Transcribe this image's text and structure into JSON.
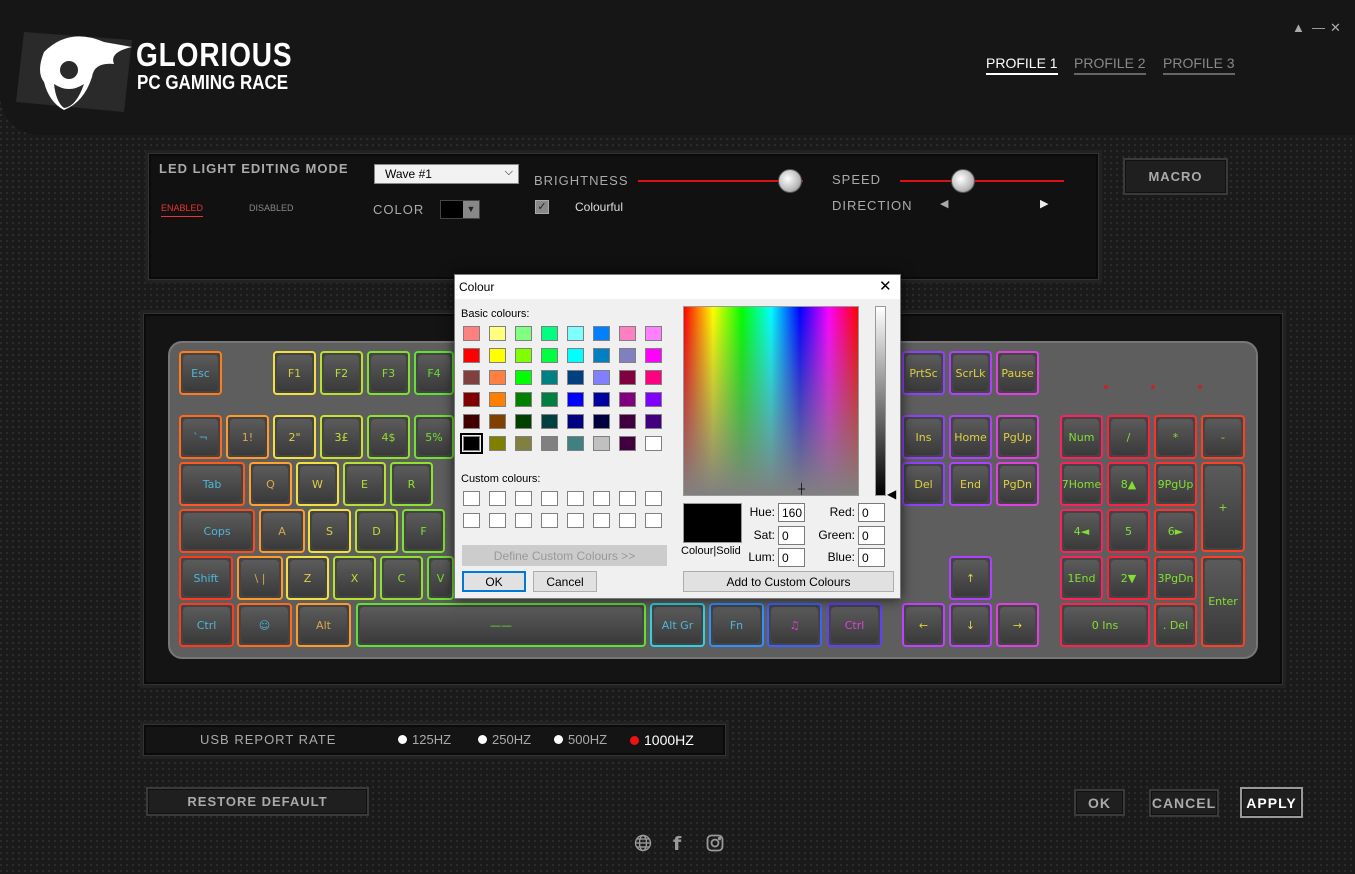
{
  "app": {
    "brand_line1": "GLORIOUS",
    "brand_line2": "PC GAMING RACE"
  },
  "window_controls": [
    "▲",
    "—",
    "✕"
  ],
  "profiles": [
    {
      "label": "PROFILE 1",
      "active": true
    },
    {
      "label": "PROFILE 2",
      "active": false
    },
    {
      "label": "PROFILE 3",
      "active": false
    }
  ],
  "led": {
    "title": "LED LIGHT EDITING MODE",
    "enabled": "ENABLED",
    "disabled": "DISABLED",
    "mode_value": "Wave #1",
    "color_label": "COLOR",
    "brightness_label": "BRIGHTNESS",
    "brightness_level": 0.88,
    "speed_label": "SPEED",
    "speed_level": 0.38,
    "direction_label": "DIRECTION",
    "colourful_label": "Colourful",
    "colourful_checked": true
  },
  "macro_label": "MACRO",
  "usb": {
    "label": "USB REPORT RATE",
    "options": [
      "125HZ",
      "250HZ",
      "500HZ",
      "1000HZ"
    ],
    "selected": "1000HZ"
  },
  "restore_label": "RESTORE DEFAULT",
  "ok_label": "OK",
  "cancel_label": "CANCEL",
  "apply_label": "APPLY",
  "social_icons": [
    "globe-icon",
    "facebook-icon",
    "instagram-icon"
  ],
  "keys": {
    "esc": "Esc",
    "f1": "F1",
    "f2": "F2",
    "f3": "F3",
    "f4": "F4",
    "grave": "`¬",
    "k1": "1!",
    "k2": "2\"",
    "k3": "3£",
    "k4": "4$",
    "k5": "5%",
    "tab": "Tab",
    "q": "Q",
    "w": "W",
    "e": "E",
    "r": "R",
    "caps": "Cops",
    "a": "A",
    "s": "S",
    "d": "D",
    "f": "F",
    "shift": "Shift",
    "bslash": "\\ |",
    "z": "Z",
    "x": "X",
    "c": "C",
    "v": "V",
    "ctrl": "Ctrl",
    "alt": "Alt",
    "altgr": "Alt Gr",
    "fn": "Fn",
    "rctrl": "Ctrl",
    "prtsc": "PrtSc",
    "scrlk": "ScrLk",
    "pause": "Pause",
    "ins": "Ins",
    "home": "Home",
    "pgup": "PgUp",
    "del": "Del",
    "end": "End",
    "pgdn": "PgDn",
    "up": "↑",
    "left": "←",
    "down": "↓",
    "right": "→",
    "num": "Num",
    "slash": "/",
    "star": "*",
    "minus": "-",
    "n7": "7Home",
    "n8": "8▲",
    "n9": "9PgUp",
    "plus": "+",
    "n4": "4◄",
    "n5": "5",
    "n6": "6►",
    "n1": "1End",
    "n2": "2▼",
    "n3": "3PgDn",
    "enter": "Enter",
    "n0": "0 Ins",
    "ndot": ". Del"
  },
  "dialog": {
    "title": "Colour",
    "basic_label": "Basic colours:",
    "custom_label": "Custom colours:",
    "define_label": "Define Custom Colours >>",
    "ok": "OK",
    "cancel": "Cancel",
    "colour_solid": "Colour|Solid",
    "add_label": "Add to Custom Colours",
    "hue_label": "Hue:",
    "sat_label": "Sat:",
    "lum_label": "Lum:",
    "red_label": "Red:",
    "green_label": "Green:",
    "blue_label": "Blue:",
    "hue": "160",
    "sat": "0",
    "lum": "0",
    "red": "0",
    "green": "0",
    "blue": "0",
    "basic_colours": [
      "#ff8080",
      "#ffff80",
      "#80ff80",
      "#00ff80",
      "#80ffff",
      "#0080ff",
      "#ff80c0",
      "#ff80ff",
      "#ff0000",
      "#ffff00",
      "#80ff00",
      "#00ff40",
      "#00ffff",
      "#0080c0",
      "#8080c0",
      "#ff00ff",
      "#804040",
      "#ff8040",
      "#00ff00",
      "#008080",
      "#004080",
      "#8080ff",
      "#800040",
      "#ff0080",
      "#800000",
      "#ff8000",
      "#008000",
      "#008040",
      "#0000ff",
      "#0000a0",
      "#800080",
      "#8000ff",
      "#400000",
      "#804000",
      "#004000",
      "#004040",
      "#000080",
      "#000040",
      "#400040",
      "#400080",
      "#000000",
      "#808000",
      "#808040",
      "#808080",
      "#408080",
      "#c0c0c0",
      "#400040",
      "#ffffff"
    ]
  }
}
